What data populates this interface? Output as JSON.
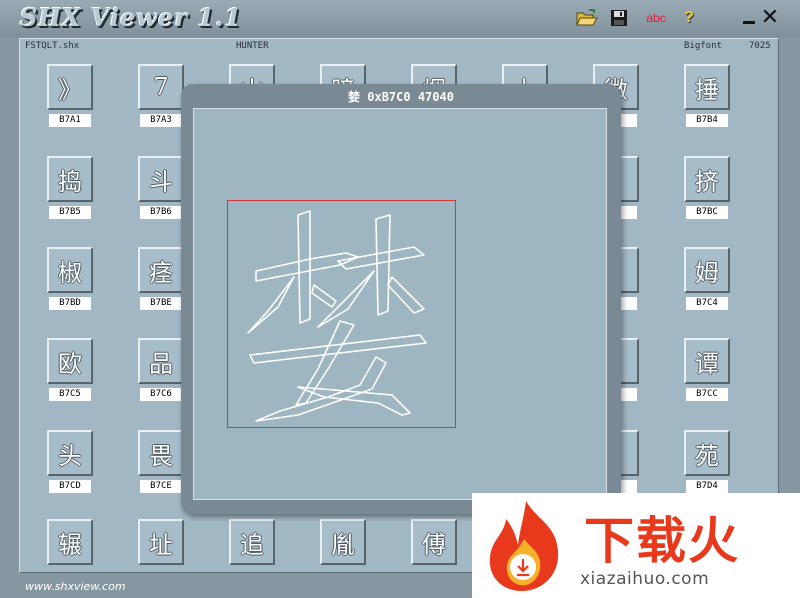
{
  "app": {
    "title": "SHX Viewer 1.1",
    "url": "www.shxview.com"
  },
  "toolbar": {
    "icons": [
      "open-folder-icon",
      "save-disk-icon",
      "abc-text-icon",
      "help-question-icon"
    ],
    "abc_label": "abc",
    "help_label": "?",
    "close_label": "✕"
  },
  "header": {
    "filename": "FSTQLT.shx",
    "author": "HUNTER",
    "font_type": "Bigfont",
    "count": "7025"
  },
  "grid": {
    "cells": [
      {
        "glyph": "》",
        "code": "B7A1"
      },
      {
        "glyph": "7",
        "code": "B7A3"
      },
      {
        "glyph": "山",
        "code": ""
      },
      {
        "glyph": "暗",
        "code": ""
      },
      {
        "glyph": "烟",
        "code": ""
      },
      {
        "glyph": "上",
        "code": ""
      },
      {
        "glyph": "微",
        "code": "B3"
      },
      {
        "glyph": "捶",
        "code": "B7B4"
      },
      {
        "glyph": "捣",
        "code": "B7B5"
      },
      {
        "glyph": "斗",
        "code": "B7B6"
      },
      {
        "glyph": "",
        "code": "B"
      },
      {
        "glyph": "挤",
        "code": "B7BC"
      },
      {
        "glyph": "椒",
        "code": "B7BD"
      },
      {
        "glyph": "痉",
        "code": "B7BE"
      },
      {
        "glyph": "",
        "code": "3"
      },
      {
        "glyph": "姆",
        "code": "B7C4"
      },
      {
        "glyph": "欧",
        "code": "B7C5"
      },
      {
        "glyph": "品",
        "code": "B7C6"
      },
      {
        "glyph": "",
        "code": "B"
      },
      {
        "glyph": "谭",
        "code": "B7CC"
      },
      {
        "glyph": "头",
        "code": "B7CD"
      },
      {
        "glyph": "畏",
        "code": "B7CE"
      },
      {
        "glyph": "",
        "code": "3"
      },
      {
        "glyph": "苑",
        "code": "B7D4"
      },
      {
        "glyph": "辗",
        "code": ""
      },
      {
        "glyph": "址",
        "code": ""
      },
      {
        "glyph": "追",
        "code": ""
      },
      {
        "glyph": "胤",
        "code": ""
      },
      {
        "glyph": "傅",
        "code": ""
      }
    ]
  },
  "popup": {
    "title": "婪 0xB7C0 47040"
  },
  "watermark": {
    "brand": "下载火",
    "domain": "xiazaihuo.com"
  },
  "colors": {
    "panel": "#a1b7c4",
    "frame": "#8797a2",
    "box_border": "#d23a3a",
    "watermark_red": "#e8391d"
  }
}
